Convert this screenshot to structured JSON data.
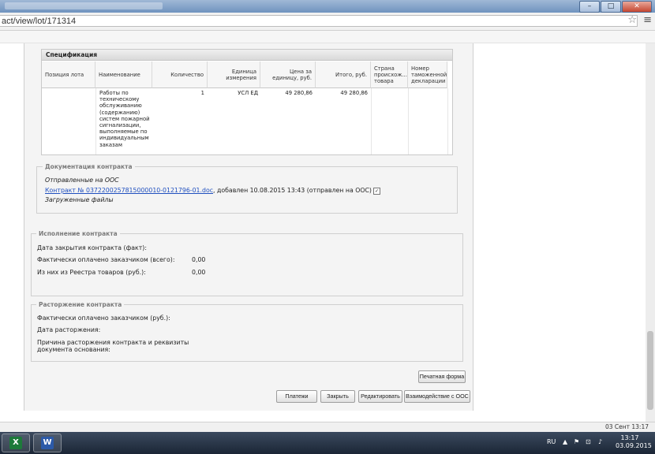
{
  "browser": {
    "url": "act/view/lot/171314"
  },
  "specification": {
    "title": "Спецификация",
    "columns": [
      "Позиция лота",
      "Наименование",
      "Количество",
      "Единица измерения",
      "Цена за единицу, руб.",
      "Итого, руб.",
      "Страна происхож... товара",
      "Номер таможенной декларации"
    ],
    "row": {
      "position": "",
      "name": "Работы по техническому обслуживанию (содержанию) систем пожарной сигнализации, выполняемые по индивидуальным заказам",
      "quantity": "1",
      "unit": "УСЛ ЕД",
      "price": "49 280,86",
      "total": "49 280,86",
      "country": "",
      "declaration": ""
    }
  },
  "contract_docs": {
    "legend": "Документация контракта",
    "sent_label": "Отправленные на ООС",
    "file_link": "Контракт № 0372200257815000010-0121796-01.doc",
    "file_info": ", добавлен 10.08.2015 13:43 (отправлен на ООС)",
    "uploaded_label": "Загруженные файлы"
  },
  "execution": {
    "legend": "Исполнение контракта",
    "close_date_label": "Дата закрытия контракта (факт):",
    "paid_total_label": "Фактически оплачено заказчиком (всего):",
    "paid_total_value": "0,00",
    "registry_label": "Из них из Реестра товаров (руб.):",
    "registry_value": "0,00"
  },
  "termination": {
    "legend": "Расторжение контракта",
    "paid_label": "Фактически оплачено заказчиком (руб.):",
    "date_label": "Дата расторжения:",
    "reason_label_1": "Причина расторжения контракта и реквизиты",
    "reason_label_2": "документа основания:"
  },
  "buttons": {
    "print_form": "Печатная форма",
    "payments": "Платежи",
    "close": "Закрыть",
    "edit": "Редактировать",
    "oos": "Взаимодействие с ООС"
  },
  "status_bar": {
    "date": "03 Сент 13:17"
  },
  "taskbar": {
    "language": "RU",
    "time": "13:17",
    "date": "03.09.2015",
    "excel_icon_letter": "X",
    "word_icon_letter": "W"
  }
}
